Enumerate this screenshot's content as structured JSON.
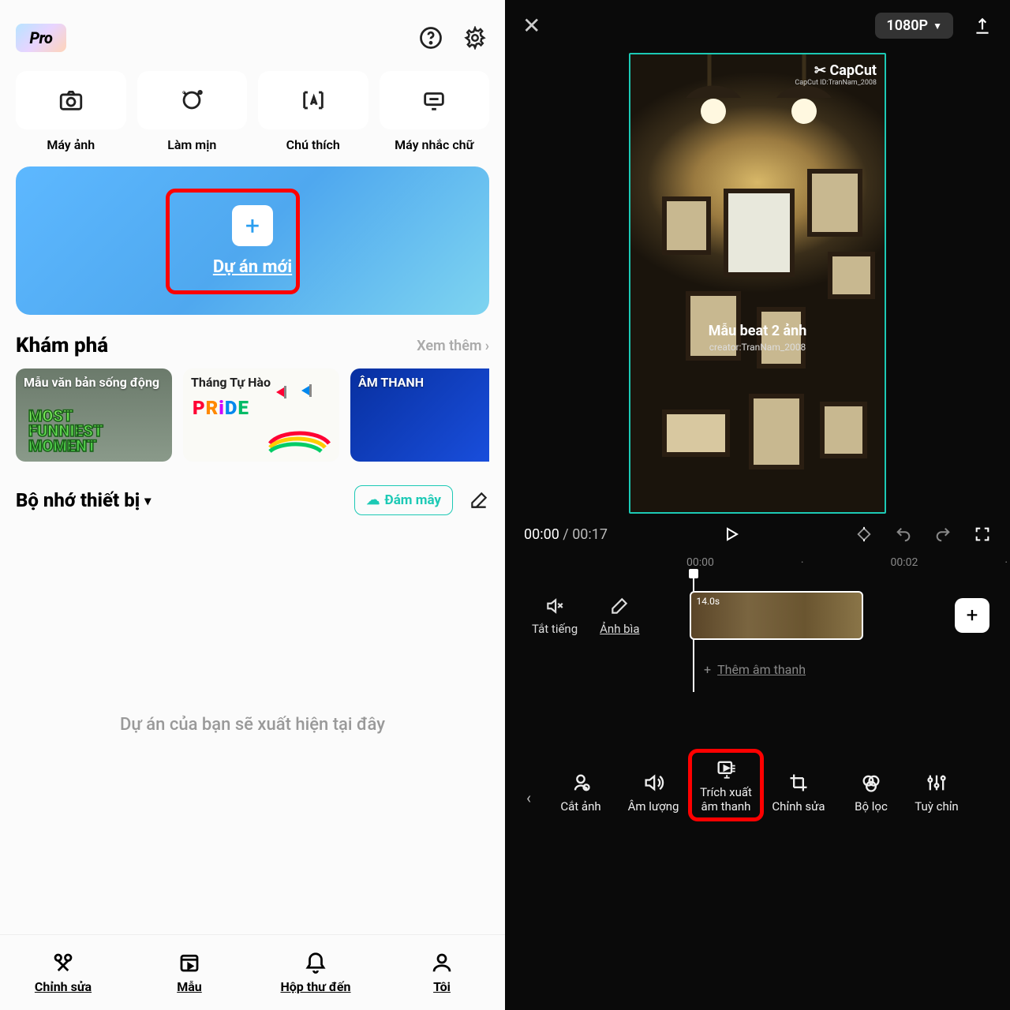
{
  "left": {
    "pro_label": "Pro",
    "tools": [
      {
        "label": "Máy ảnh"
      },
      {
        "label": "Làm mịn"
      },
      {
        "label": "Chú thích"
      },
      {
        "label": "Máy nhắc chữ"
      }
    ],
    "new_project": "Dự án mới",
    "explore": {
      "title": "Khám phá",
      "more": "Xem thêm",
      "templates": [
        {
          "caption": "Mẫu văn bản sống động",
          "inner": "MOST\nFUNNIEST\nMOMENT"
        },
        {
          "caption": "Tháng Tự Hào",
          "inner": "PRIDE"
        },
        {
          "caption": "ÂM THANH"
        }
      ]
    },
    "storage": {
      "title": "Bộ nhớ thiết bị",
      "cloud": "Đám mây"
    },
    "empty": "Dự án của bạn sẽ xuất hiện tại đây",
    "nav": [
      {
        "label": "Chỉnh sửa"
      },
      {
        "label": "Mẫu"
      },
      {
        "label": "Hộp thư đến"
      },
      {
        "label": "Tôi"
      }
    ]
  },
  "right": {
    "resolution": "1080P",
    "watermark": {
      "brand": "✂ CapCut",
      "id": "CapCut ID:TranNam_2008"
    },
    "preview": {
      "title": "Mẫu beat 2 ảnh",
      "subtitle": "creator:TranNam_2008"
    },
    "time": {
      "current": "00:00",
      "total": "00:17"
    },
    "ruler": [
      "00:00",
      "00:02"
    ],
    "timeline": {
      "mute": "Tắt tiếng",
      "cover": "Ảnh bìa",
      "clip_duration": "14.0s",
      "add_audio": "Thêm âm thanh"
    },
    "bottom": [
      {
        "label": "Cắt ảnh"
      },
      {
        "label": "Âm lượng"
      },
      {
        "label": "Trích xuất âm thanh"
      },
      {
        "label": "Chỉnh sửa"
      },
      {
        "label": "Bộ lọc"
      },
      {
        "label": "Tuỳ chỉnh"
      }
    ]
  }
}
